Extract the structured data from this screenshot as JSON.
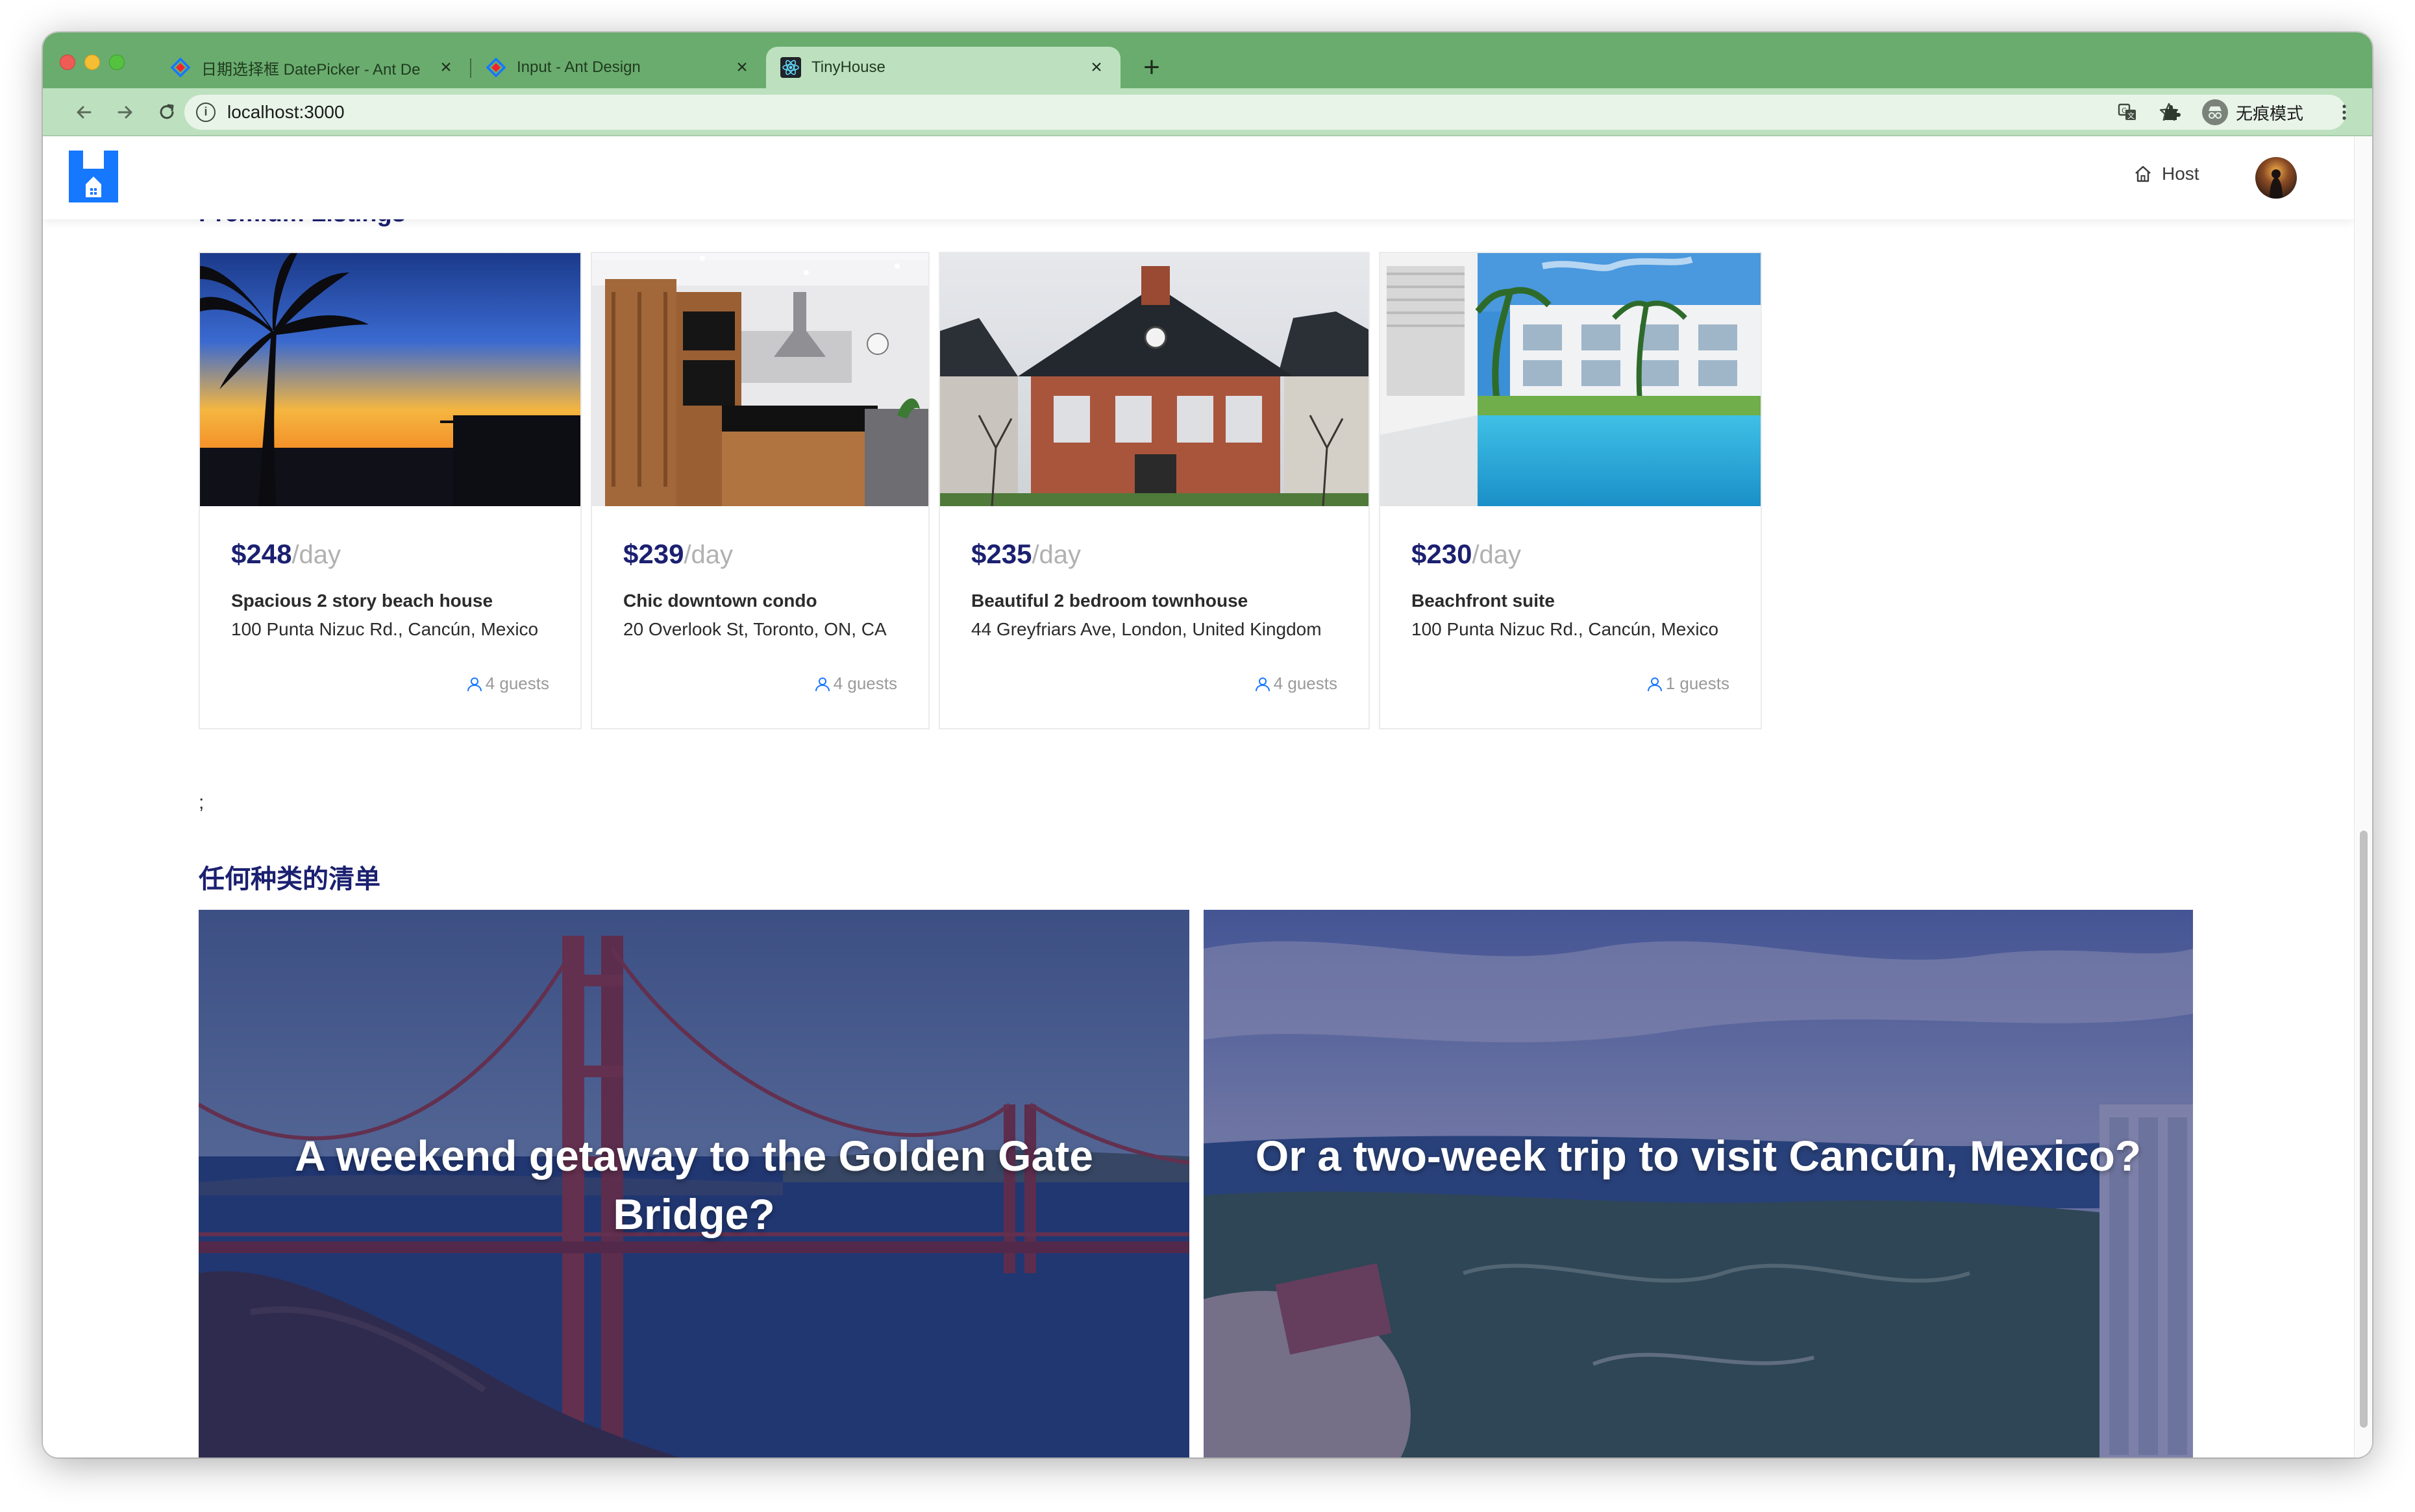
{
  "browser": {
    "tabs": [
      {
        "title": "日期选择框 DatePicker - Ant De",
        "favicon": "ant-design-icon",
        "active": false
      },
      {
        "title": "Input - Ant Design",
        "favicon": "ant-design-icon",
        "active": false
      },
      {
        "title": "TinyHouse",
        "favicon": "react-icon",
        "active": true
      }
    ],
    "url": "localhost:3000",
    "profile_label": "无痕模式",
    "accent_color": "#6aac6e"
  },
  "header": {
    "logo": "tinyhouse-logo",
    "host_label": "Host"
  },
  "premium": {
    "title": "Premium Listings",
    "listings": [
      {
        "price": "$248",
        "per": "/day",
        "title": "Spacious 2 story beach house",
        "address": "100 Punta Nizuc Rd., Cancún, Mexico",
        "guests": "4 guests",
        "image": "sunset-palm"
      },
      {
        "price": "$239",
        "per": "/day",
        "title": "Chic downtown condo",
        "address": "20 Overlook St, Toronto, ON, CA",
        "guests": "4 guests",
        "image": "modern-kitchen"
      },
      {
        "price": "$235",
        "per": "/day",
        "title": "Beautiful 2 bedroom townhouse",
        "address": "44 Greyfriars Ave, London, United Kingdom",
        "guests": "4 guests",
        "image": "brick-townhouse"
      },
      {
        "price": "$230",
        "per": "/day",
        "title": "Beachfront suite",
        "address": "100 Punta Nizuc Rd., Cancún, Mexico",
        "guests": "1 guests",
        "image": "resort-pool"
      }
    ]
  },
  "stray_text": ";",
  "any_kind": {
    "title": "任何种类的清单",
    "promos": [
      {
        "text": "A weekend getaway to the Golden Gate Bridge?",
        "image": "golden-gate-bridge"
      },
      {
        "text": "Or a two-week trip to visit Cancún, Mexico?",
        "image": "cancun-aerial"
      }
    ]
  },
  "colors": {
    "brand": "#1b2070",
    "logo_blue": "#1677ff",
    "muted": "#b1b1b1"
  }
}
